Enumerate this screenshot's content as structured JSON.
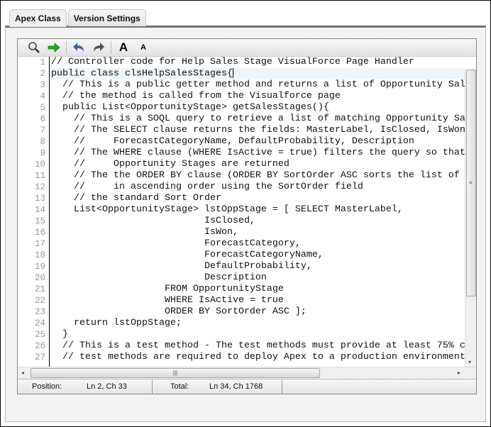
{
  "tabs": [
    {
      "label": "Apex Class",
      "active": true
    },
    {
      "label": "Version Settings",
      "active": false
    }
  ],
  "toolbar": {
    "icons": [
      "search-icon",
      "go-to-line-arrow-icon",
      "undo-icon",
      "redo-icon",
      "font-larger-icon",
      "font-smaller-icon"
    ],
    "font_large": "A",
    "font_small": "A"
  },
  "code_lines": [
    "// Controller code for Help Sales Stage VisualForce Page Handler",
    "public class clsHelpSalesStages{",
    "  // This is a public getter method and returns a list of Opportunity Sal",
    "  // the method is called from the Visualforce page",
    "  public List<OpportunityStage> getSalesStages(){",
    "    // This is a SOQL query to retrieve a list of matching Opportunity Sa",
    "    // The SELECT clause returns the fields: MasterLabel, IsClosed, IsWon",
    "    //     ForecastCategoryName, DefaultProbability, Description",
    "    // The WHERE clause (WHERE IsActive = true) filters the query so that",
    "    //     Opportunity Stages are returned",
    "    // The the ORDER BY clause (ORDER BY SortOrder ASC sorts the list of",
    "    //     in ascending order using the SortOrder field",
    "    // the standard Sort Order",
    "    List<OpportunityStage> lstOppStage = [ SELECT MasterLabel,",
    "                           IsClosed,",
    "                           IsWon,",
    "                           ForecastCategory,",
    "                           ForecastCategoryName,",
    "                           DefaultProbability,",
    "                           Description",
    "                    FROM OpportunityStage",
    "                    WHERE IsActive = true",
    "                    ORDER BY SortOrder ASC ];",
    "    return lstOppStage;",
    "  }",
    "  // This is a test method - The test methods must provide at least 75% c",
    "  // test methods are required to deploy Apex to a production environment"
  ],
  "current_line": 2,
  "status": {
    "position_label": "Position:",
    "position_value": "Ln 2, Ch 33",
    "total_label": "Total:",
    "total_value": "Ln 34, Ch 1768"
  },
  "colors": {
    "tab_underline": "#6f7177",
    "current_line_bg": "#eef5fb",
    "go_arrow": "#22aa22",
    "undo": "#3b5fa8"
  }
}
